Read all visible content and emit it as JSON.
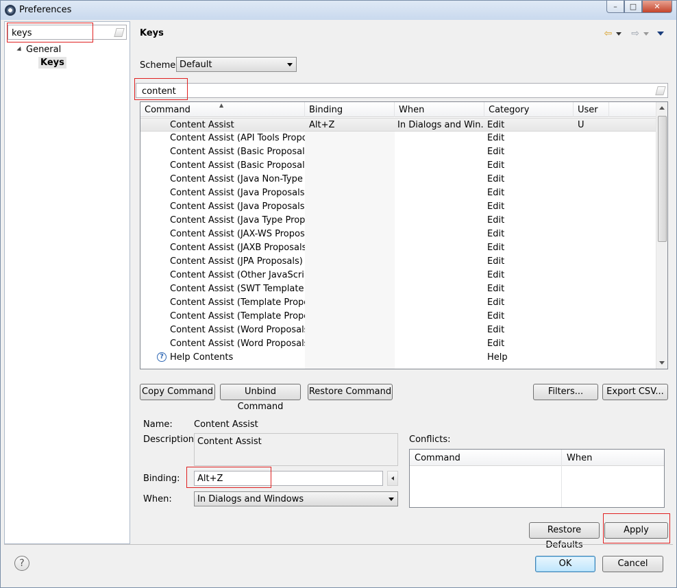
{
  "window": {
    "title": "Preferences",
    "controls": {
      "minimize": "–",
      "maximize": "□",
      "close": "✕"
    }
  },
  "sidebar": {
    "filter_value": "keys",
    "tree": [
      {
        "label": "General",
        "expanded": true
      },
      {
        "label": "Keys",
        "selected": true
      }
    ]
  },
  "main": {
    "title": "Keys",
    "nav": {
      "back": "⇦",
      "forward": "⇨"
    },
    "scheme_label": "Scheme:",
    "scheme_value": "Default",
    "filter_value": "content",
    "table": {
      "columns": [
        "Command",
        "Binding",
        "When",
        "Category",
        "User"
      ],
      "rows": [
        {
          "command": "Content Assist",
          "binding": "Alt+Z",
          "when": "In Dialogs and Win...",
          "category": "Edit",
          "user": "U"
        },
        {
          "command": "Content Assist (API Tools Proposa",
          "binding": "",
          "when": "",
          "category": "Edit",
          "user": ""
        },
        {
          "command": "Content Assist (Basic Proposals)",
          "binding": "",
          "when": "",
          "category": "Edit",
          "user": ""
        },
        {
          "command": "Content Assist (Basic Proposals)",
          "binding": "",
          "when": "",
          "category": "Edit",
          "user": ""
        },
        {
          "command": "Content Assist (Java Non-Type Pro",
          "binding": "",
          "when": "",
          "category": "Edit",
          "user": ""
        },
        {
          "command": "Content Assist (Java Proposals (Ta",
          "binding": "",
          "when": "",
          "category": "Edit",
          "user": ""
        },
        {
          "command": "Content Assist (Java Proposals)",
          "binding": "",
          "when": "",
          "category": "Edit",
          "user": ""
        },
        {
          "command": "Content Assist (Java Type Proposa",
          "binding": "",
          "when": "",
          "category": "Edit",
          "user": ""
        },
        {
          "command": "Content Assist (JAX-WS Proposals",
          "binding": "",
          "when": "",
          "category": "Edit",
          "user": ""
        },
        {
          "command": "Content Assist (JAXB Proposals)",
          "binding": "",
          "when": "",
          "category": "Edit",
          "user": ""
        },
        {
          "command": "Content Assist (JPA Proposals)",
          "binding": "",
          "when": "",
          "category": "Edit",
          "user": ""
        },
        {
          "command": "Content Assist (Other JavaScript P",
          "binding": "",
          "when": "",
          "category": "Edit",
          "user": ""
        },
        {
          "command": "Content Assist (SWT Template Pro",
          "binding": "",
          "when": "",
          "category": "Edit",
          "user": ""
        },
        {
          "command": "Content Assist (Template Proposa",
          "binding": "",
          "when": "",
          "category": "Edit",
          "user": ""
        },
        {
          "command": "Content Assist (Template Proposa",
          "binding": "",
          "when": "",
          "category": "Edit",
          "user": ""
        },
        {
          "command": "Content Assist (Word Proposals)",
          "binding": "",
          "when": "",
          "category": "Edit",
          "user": ""
        },
        {
          "command": "Content Assist (Word Proposals)",
          "binding": "",
          "when": "",
          "category": "Edit",
          "user": ""
        },
        {
          "command": "Help Contents",
          "binding": "",
          "when": "",
          "category": "Help",
          "user": "",
          "icon": "help-icon"
        }
      ]
    },
    "buttons": {
      "copy_command": "Copy Command",
      "unbind_command": "Unbind Command",
      "restore_command": "Restore Command",
      "filters": "Filters...",
      "export_csv": "Export CSV..."
    },
    "details": {
      "name_label": "Name:",
      "name_value": "Content Assist",
      "description_label": "Description:",
      "description_value": "Content Assist",
      "binding_label": "Binding:",
      "binding_value": "Alt+Z",
      "when_label": "When:",
      "when_value": "In Dialogs and Windows",
      "conflicts_label": "Conflicts:",
      "conflicts_columns": [
        "Command",
        "When"
      ]
    },
    "restore_defaults": "Restore Defaults",
    "apply": "Apply"
  },
  "footer": {
    "help": "?",
    "ok": "OK",
    "cancel": "Cancel"
  }
}
